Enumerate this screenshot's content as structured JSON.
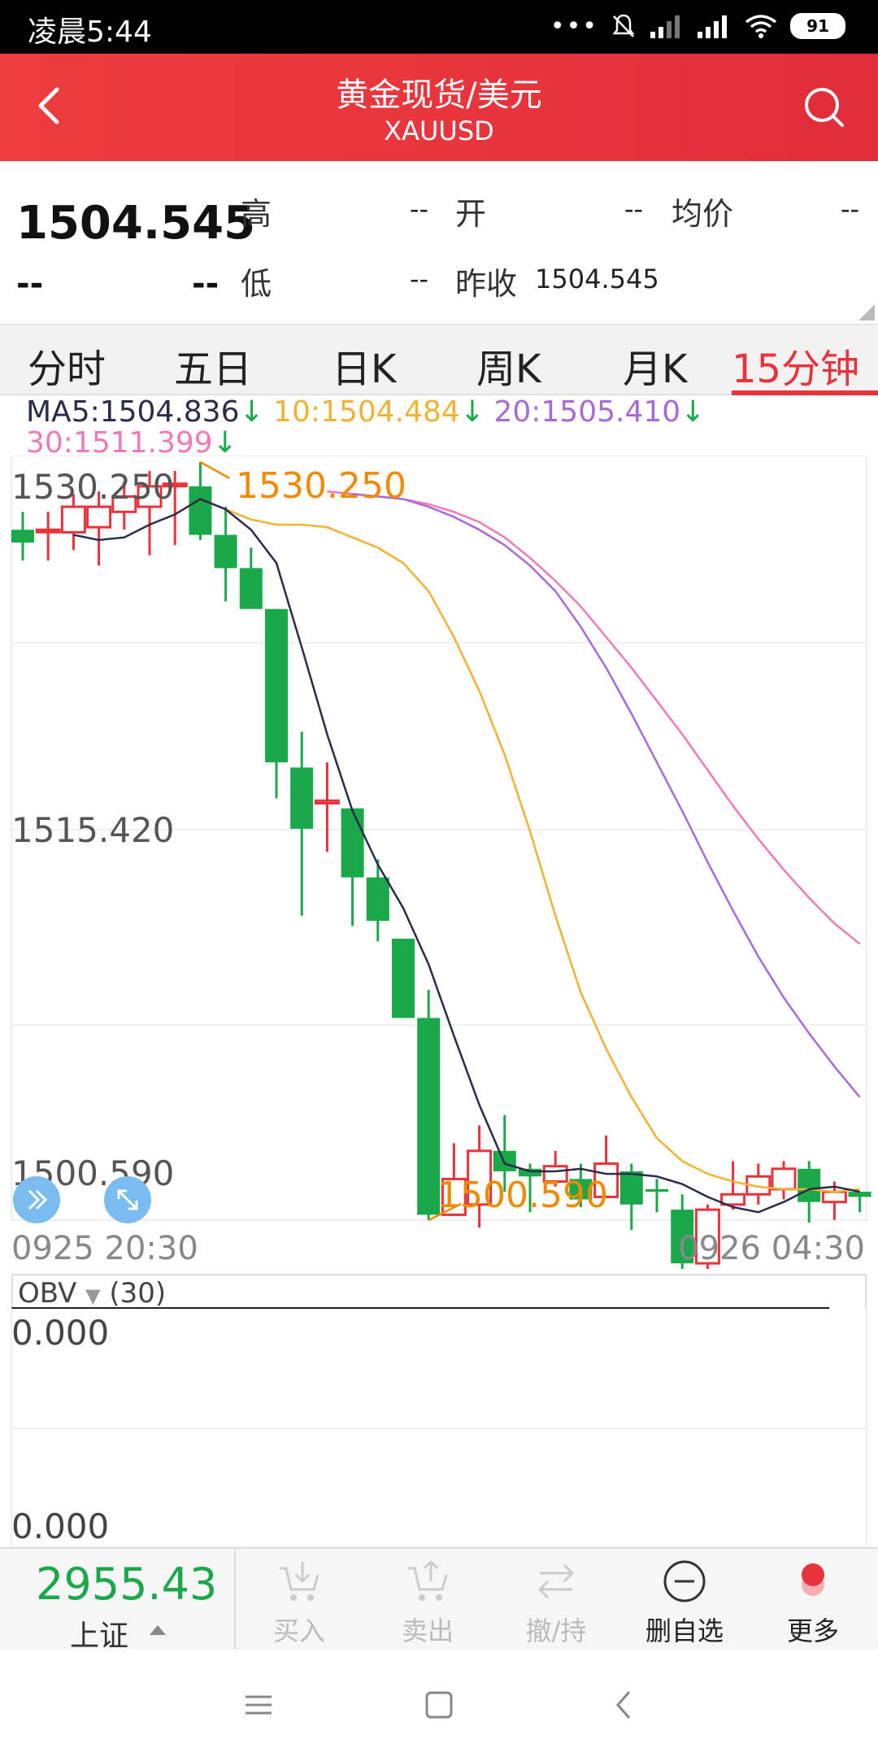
{
  "status_bar": {
    "time": "凌晨5:44",
    "battery": "91"
  },
  "header": {
    "title": "黄金现货/美元",
    "subtitle": "XAUUSD"
  },
  "quote": {
    "price": "1504.545",
    "change": "--",
    "change_pct": "--",
    "high_label": "高",
    "high": "--",
    "open_label": "开",
    "open": "--",
    "avg_label": "均价",
    "avg": "--",
    "low_label": "低",
    "low": "--",
    "prev_close_label": "昨收",
    "prev_close": "1504.545"
  },
  "tabs": [
    {
      "label": "分时"
    },
    {
      "label": "五日"
    },
    {
      "label": "日K"
    },
    {
      "label": "周K"
    },
    {
      "label": "月K"
    },
    {
      "label": "15分钟",
      "active": true
    }
  ],
  "ma_legend": {
    "ma5": "MA5:1504.836",
    "ma10": "10:1504.484",
    "ma20": "20:1505.410",
    "ma30": "30:1511.399",
    "arrow": "↓"
  },
  "chart": {
    "y_top_label": "1530.250",
    "y_mid_label": "1515.420",
    "y_bottom_label": "1500.590",
    "high_marker": "1530.250",
    "low_marker": "1500.590",
    "x_start": "0925 20:30",
    "x_end": "0926 04:30"
  },
  "obv": {
    "label": "OBV",
    "param": "(30)",
    "top_value": "0.000",
    "bottom_value": "0.000"
  },
  "bottom_bar": {
    "index_value": "2955.43",
    "index_name": "上证",
    "buy": "买入",
    "sell": "卖出",
    "cancel": "撤/持",
    "remove_watch": "删自选",
    "more": "更多"
  },
  "colors": {
    "up": "#e8323c",
    "down": "#1aa84a",
    "ma5": "#2b2b4a",
    "ma10": "#f2b233",
    "ma20": "#a86bd6",
    "ma30": "#f07ab8",
    "marker": "#f08a00"
  },
  "chart_data": {
    "type": "candlestick",
    "ylim": [
      1500.59,
      1530.25
    ],
    "x_start": "0925 20:30",
    "x_end": "0926 04:30",
    "candles": [
      {
        "o": 1527.6,
        "c": 1527.1,
        "h": 1528.3,
        "l": 1526.4
      },
      {
        "o": 1527.6,
        "c": 1527.6,
        "h": 1528.3,
        "l": 1526.4
      },
      {
        "o": 1527.5,
        "c": 1528.5,
        "h": 1529.0,
        "l": 1526.8
      },
      {
        "o": 1527.7,
        "c": 1528.5,
        "h": 1529.1,
        "l": 1526.2
      },
      {
        "o": 1528.3,
        "c": 1528.9,
        "h": 1529.5,
        "l": 1527.6
      },
      {
        "o": 1528.5,
        "c": 1529.3,
        "h": 1529.9,
        "l": 1526.6
      },
      {
        "o": 1529.4,
        "c": 1529.4,
        "h": 1529.9,
        "l": 1527.0
      },
      {
        "o": 1529.3,
        "c": 1527.4,
        "h": 1530.25,
        "l": 1527.2
      },
      {
        "o": 1527.4,
        "c": 1526.1,
        "h": 1528.5,
        "l": 1524.8
      },
      {
        "o": 1526.1,
        "c": 1524.5,
        "h": 1526.9,
        "l": 1524.5
      },
      {
        "o": 1524.5,
        "c": 1518.5,
        "h": 1524.5,
        "l": 1517.1
      },
      {
        "o": 1518.3,
        "c": 1515.9,
        "h": 1519.7,
        "l": 1512.5
      },
      {
        "o": 1516.9,
        "c": 1517.0,
        "h": 1518.5,
        "l": 1515.0
      },
      {
        "o": 1516.7,
        "c": 1514.0,
        "h": 1516.7,
        "l": 1512.1
      },
      {
        "o": 1514.0,
        "c": 1512.3,
        "h": 1514.7,
        "l": 1511.5
      },
      {
        "o": 1511.6,
        "c": 1508.5,
        "h": 1511.6,
        "l": 1508.5
      },
      {
        "o": 1508.5,
        "c": 1500.8,
        "h": 1509.6,
        "l": 1500.59
      },
      {
        "o": 1500.8,
        "c": 1502.2,
        "h": 1503.6,
        "l": 1501.0
      },
      {
        "o": 1501.2,
        "c": 1503.3,
        "h": 1504.3,
        "l": 1500.3
      },
      {
        "o": 1503.3,
        "c": 1502.5,
        "h": 1504.7,
        "l": 1501.7
      },
      {
        "o": 1502.6,
        "c": 1502.3,
        "h": 1502.8,
        "l": 1500.9
      },
      {
        "o": 1502.1,
        "c": 1502.7,
        "h": 1503.3,
        "l": 1501.9
      },
      {
        "o": 1502.2,
        "c": 1501.4,
        "h": 1502.8,
        "l": 1501.1
      },
      {
        "o": 1501.5,
        "c": 1502.8,
        "h": 1503.9,
        "l": 1501.5
      },
      {
        "o": 1502.5,
        "c": 1501.2,
        "h": 1502.8,
        "l": 1500.2
      },
      {
        "o": 1501.8,
        "c": 1501.7,
        "h": 1502.2,
        "l": 1500.9
      },
      {
        "o": 1501.0,
        "c": 1498.9,
        "h": 1501.6,
        "l": 1497.8
      },
      {
        "o": 1498.9,
        "c": 1501.0,
        "h": 1501.2,
        "l": 1498.2
      },
      {
        "o": 1501.2,
        "c": 1501.6,
        "h": 1502.9,
        "l": 1501.0
      },
      {
        "o": 1501.6,
        "c": 1502.3,
        "h": 1502.8,
        "l": 1501.2
      },
      {
        "o": 1501.8,
        "c": 1502.6,
        "h": 1502.9,
        "l": 1501.4
      },
      {
        "o": 1502.6,
        "c": 1501.3,
        "h": 1502.9,
        "l": 1500.5
      },
      {
        "o": 1501.3,
        "c": 1501.7,
        "h": 1502.1,
        "l": 1500.6
      },
      {
        "o": 1501.7,
        "c": 1501.5,
        "h": 1501.7,
        "l": 1500.9
      }
    ],
    "ma5": [
      1527.4,
      1527.2,
      1527.3,
      1527.8,
      1528.2,
      1528.8,
      1528.4,
      1527.6,
      1526.3,
      1523.0,
      1519.6,
      1516.6,
      1514.5,
      1512.8,
      1510.6,
      1507.8,
      1505.1,
      1502.8,
      1502.5,
      1502.5,
      1502.6,
      1502.4,
      1502.4,
      1502.3,
      1502.0,
      1501.5,
      1501.1,
      1500.9,
      1501.3,
      1501.8,
      1501.9,
      1501.7
    ],
    "ma10": [
      1528.4,
      1528.0,
      1527.8,
      1527.8,
      1527.7,
      1527.3,
      1526.9,
      1526.3,
      1525.2,
      1523.4,
      1521.3,
      1518.8,
      1515.8,
      1512.5,
      1509.5,
      1507.3,
      1505.4,
      1503.8,
      1502.9,
      1502.4,
      1502.1,
      1501.9,
      1501.8,
      1501.8,
      1501.7,
      1501.8
    ],
    "ma20": [
      1529.0,
      1528.9,
      1528.8,
      1528.5,
      1528.1,
      1527.6,
      1527.0,
      1526.2,
      1525.2,
      1523.8,
      1522.2,
      1520.4,
      1518.5,
      1516.6,
      1514.6,
      1512.7,
      1510.9,
      1509.3,
      1507.9,
      1506.6,
      1505.4
    ],
    "ma30": [
      1529.1,
      1529.0,
      1528.9,
      1528.8,
      1528.6,
      1528.3,
      1527.9,
      1527.3,
      1526.5,
      1525.6,
      1524.6,
      1523.4,
      1522.2,
      1520.9,
      1519.6,
      1518.2,
      1516.8,
      1515.5,
      1514.3,
      1513.2,
      1512.2,
      1511.4
    ]
  }
}
